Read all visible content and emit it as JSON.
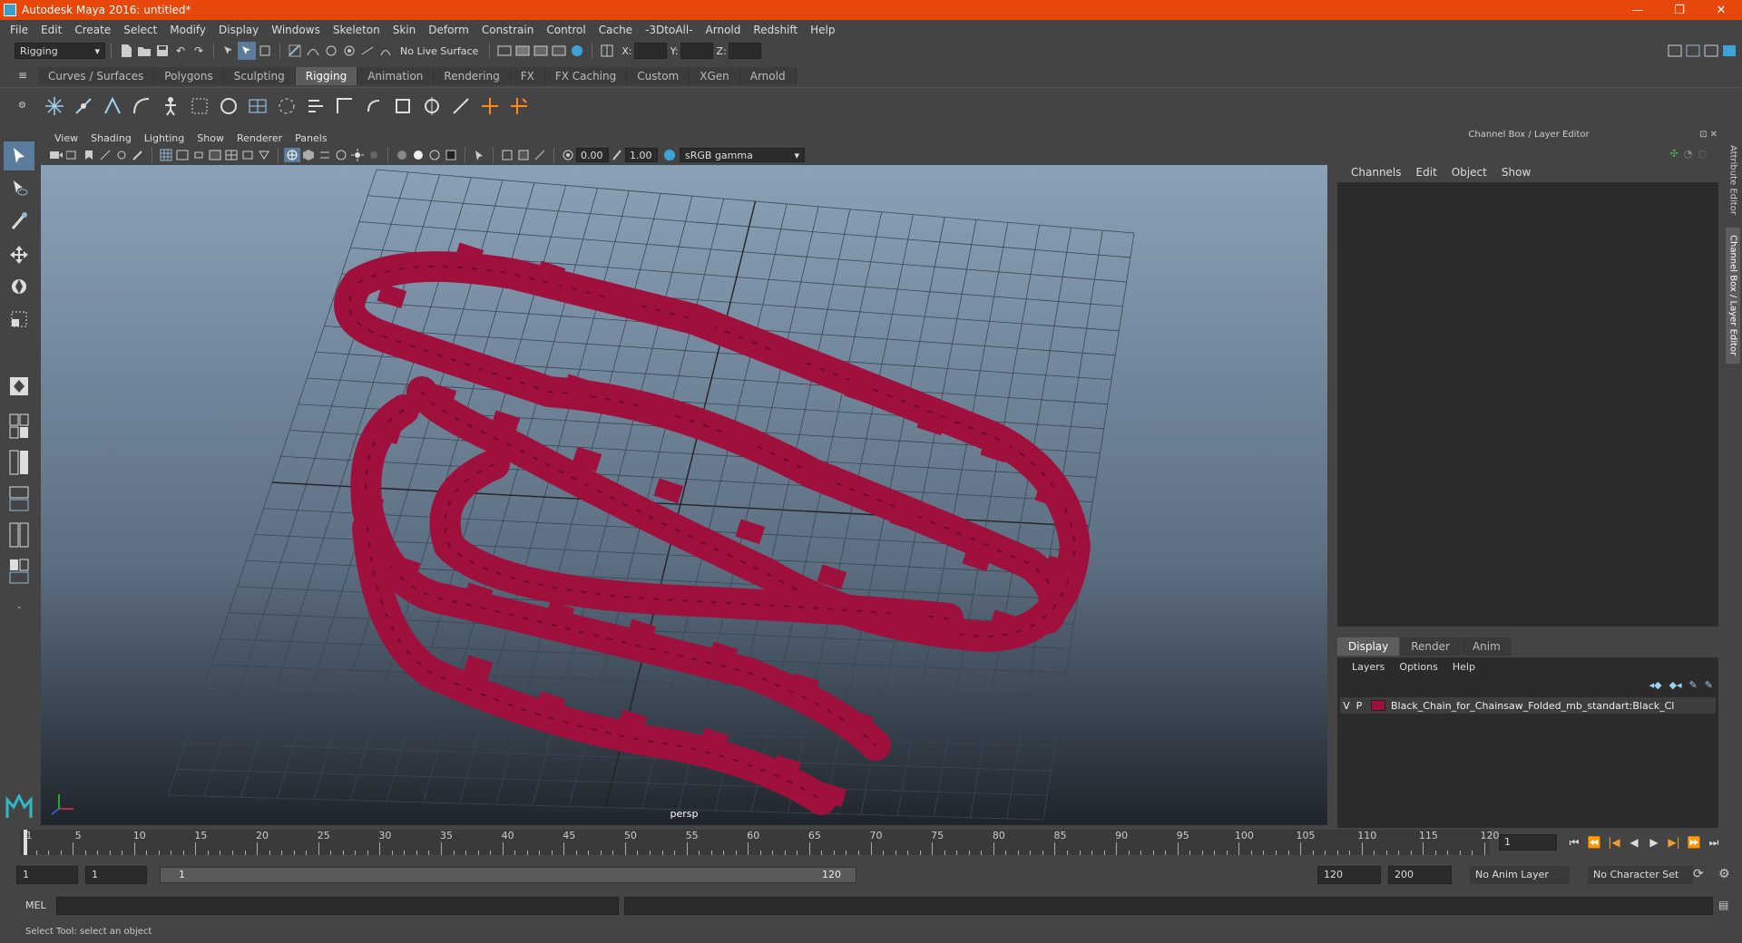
{
  "window": {
    "title": "Autodesk Maya 2016: untitled*",
    "controls": [
      "—",
      "❐",
      "✕"
    ]
  },
  "menubar": [
    "File",
    "Edit",
    "Create",
    "Select",
    "Modify",
    "Display",
    "Windows",
    "Skeleton",
    "Skin",
    "Deform",
    "Constrain",
    "Control",
    "Cache",
    "-3DtoAll-",
    "Arnold",
    "Redshift",
    "Help"
  ],
  "statusline": {
    "menuset": "Rigging",
    "live_surface": "No Live Surface",
    "x_label": "X:",
    "y_label": "Y:",
    "z_label": "Z:"
  },
  "shelf": {
    "tabs": [
      "Curves / Surfaces",
      "Polygons",
      "Sculpting",
      "Rigging",
      "Animation",
      "Rendering",
      "FX",
      "FX Caching",
      "Custom",
      "XGen",
      "Arnold"
    ],
    "active_tab": "Rigging"
  },
  "viewport": {
    "menu": [
      "View",
      "Shading",
      "Lighting",
      "Show",
      "Renderer",
      "Panels"
    ],
    "exposure": "0.00",
    "gamma": "1.00",
    "color_space": "sRGB gamma",
    "camera": "persp",
    "mesh_color": "#a0103c"
  },
  "channel_box": {
    "title": "Channel Box / Layer Editor",
    "menu": [
      "Channels",
      "Edit",
      "Object",
      "Show"
    ]
  },
  "layer_editor": {
    "tabs": [
      "Display",
      "Render",
      "Anim"
    ],
    "active_tab": "Display",
    "menu": [
      "Layers",
      "Options",
      "Help"
    ],
    "layers": [
      {
        "v": "V",
        "p": "P",
        "name": "Black_Chain_for_Chainsaw_Folded_mb_standart:Black_Cl",
        "color": "#a0103c"
      }
    ]
  },
  "side_tabs": [
    "Attribute Editor",
    "Channel Box / Layer Editor"
  ],
  "timeline": {
    "ticks": [
      1,
      5,
      10,
      15,
      20,
      25,
      30,
      35,
      40,
      45,
      50,
      55,
      60,
      65,
      70,
      75,
      80,
      85,
      90,
      95,
      100,
      105,
      110,
      115,
      120
    ],
    "current_frame": "1"
  },
  "range": {
    "start": "1",
    "playback_start": "1",
    "slider_start": "1",
    "slider_end": "120",
    "playback_end": "120",
    "end": "200",
    "anim_layer": "No Anim Layer",
    "character_set": "No Character Set"
  },
  "command_line": {
    "label": "MEL"
  },
  "help_line": "Select Tool: select an object"
}
